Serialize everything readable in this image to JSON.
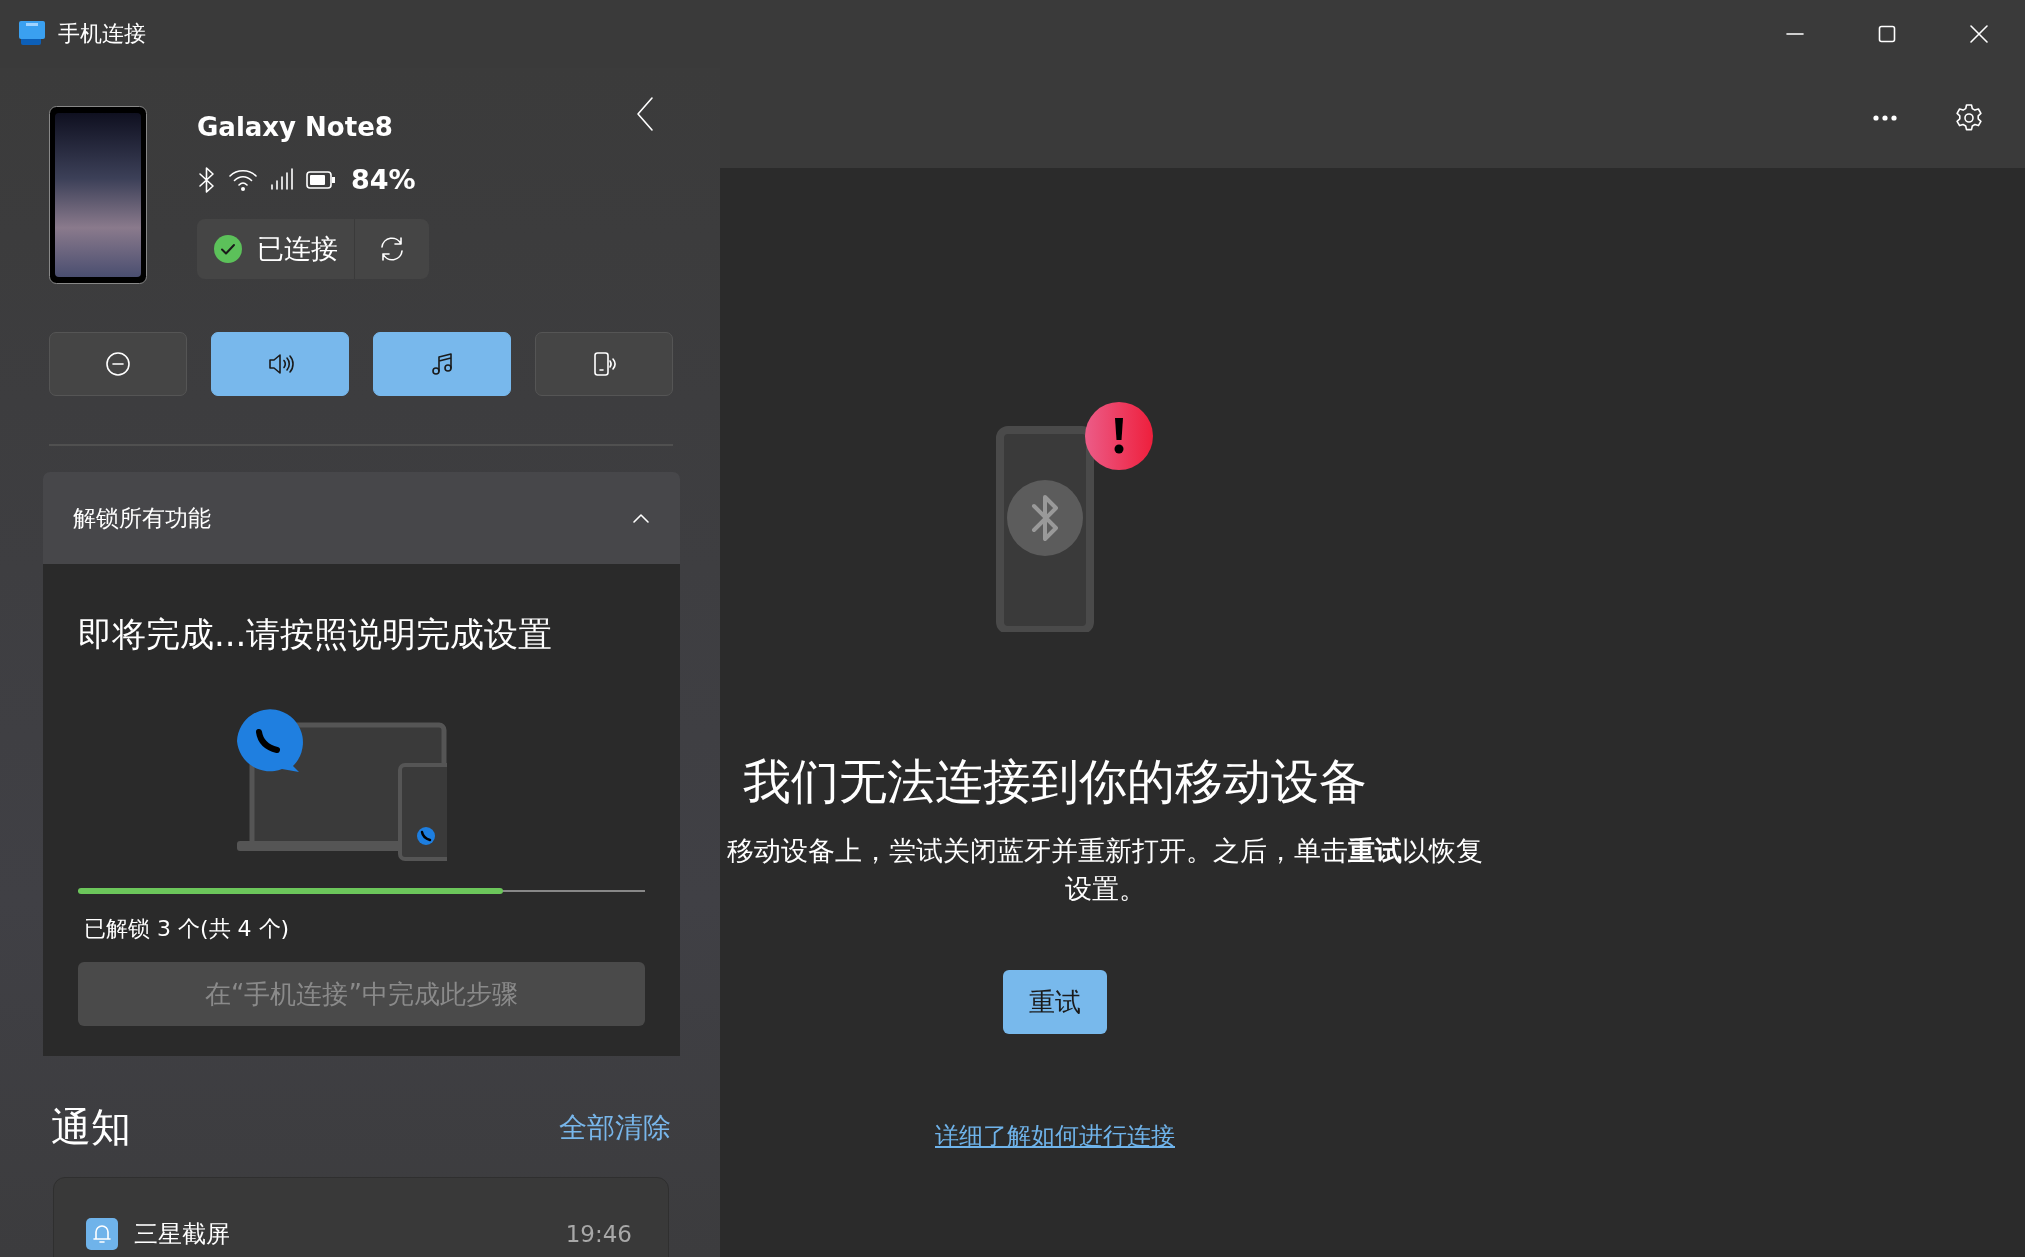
{
  "window": {
    "title": "手机连接"
  },
  "device": {
    "name": "Galaxy Note8",
    "battery": "84%",
    "status": "已连接"
  },
  "quick_actions": [
    {
      "kind": "do-not-disturb",
      "on": false
    },
    {
      "kind": "audio",
      "on": true
    },
    {
      "kind": "media",
      "on": true
    },
    {
      "kind": "phone-audio",
      "on": false
    }
  ],
  "unlock_card": {
    "title": "解锁所有功能",
    "expanded": true,
    "heading": "即将完成...请按照说明完成设置",
    "level": 0.75,
    "progress_text": "已解锁 3 个(共 4 个)",
    "action": "在“手机连接”中完成此步骤",
    "action_disabled": true
  },
  "notifications": {
    "title": "通知",
    "clear_all": "全部清除",
    "items": [
      {
        "app": "三星截屏",
        "time": "19:46"
      }
    ]
  },
  "error": {
    "title": "我们无法连接到你的移动设备",
    "message": "移动设备上，尝试关闭蓝牙并重新打开。之后，单击**重试**以恢复设置。",
    "retry": "重试",
    "help_link": "详细了解如何进行连接"
  }
}
